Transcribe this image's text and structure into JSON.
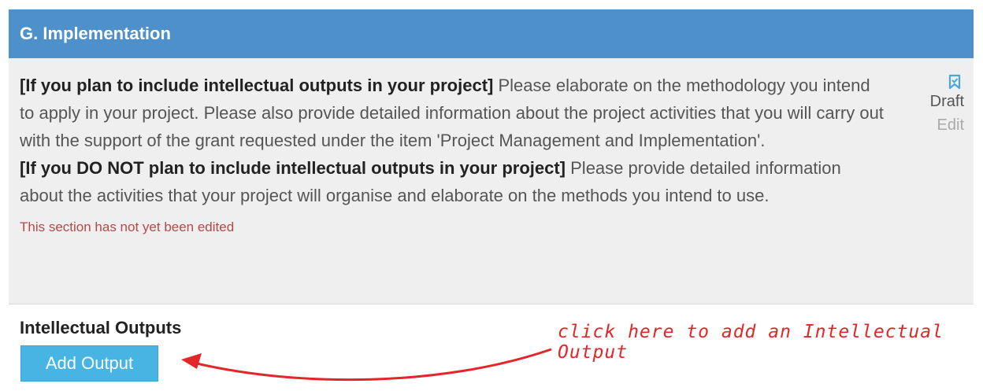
{
  "section": {
    "title": "G. Implementation",
    "para1_lead": "[If you plan to include intellectual outputs in your project]",
    "para1_text": " Please elaborate on the methodology you intend to apply in your project. Please also provide detailed information about the project activities that you will carry out with the support of the grant requested under the item 'Project Management and Implementation'.",
    "para2_lead": "[If you DO NOT plan to include intellectual outputs in your project]",
    "para2_text": " Please provide detailed information about the activities that your project will organise and elaborate on the methods you intend to use.",
    "note": "This section has not yet been edited",
    "status": "Draft",
    "edit_label": "Edit",
    "status_icon": "bookmark-icon"
  },
  "outputs": {
    "title": "Intellectual Outputs",
    "add_button": "Add Output"
  },
  "annotation": {
    "text": "click here to add an Intellectual Output",
    "color": "#e3262a"
  },
  "colors": {
    "header": "#4e90c9",
    "button": "#47b4e3",
    "note": "#b24a4a"
  }
}
